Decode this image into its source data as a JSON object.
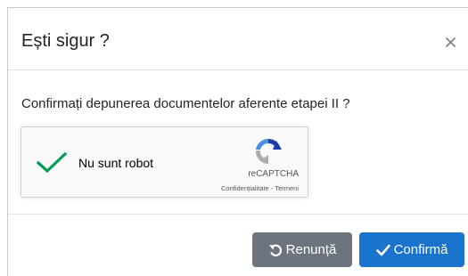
{
  "dialog": {
    "title": "Ești sigur ?",
    "close_label": "×",
    "question": "Confirmați depunerea documentelor aferente etapei II ?"
  },
  "recaptcha": {
    "label": "Nu sunt robot",
    "checked": true,
    "brand": "reCAPTCHA",
    "privacy_link": "Confidențialitate",
    "separator": " - ",
    "terms_link": "Termeni"
  },
  "buttons": {
    "cancel_label": "Renunță",
    "confirm_label": "Confirmă"
  },
  "colors": {
    "cancel_bg": "#6c757d",
    "confirm_bg": "#1a73cc",
    "check_green": "#009e55"
  }
}
